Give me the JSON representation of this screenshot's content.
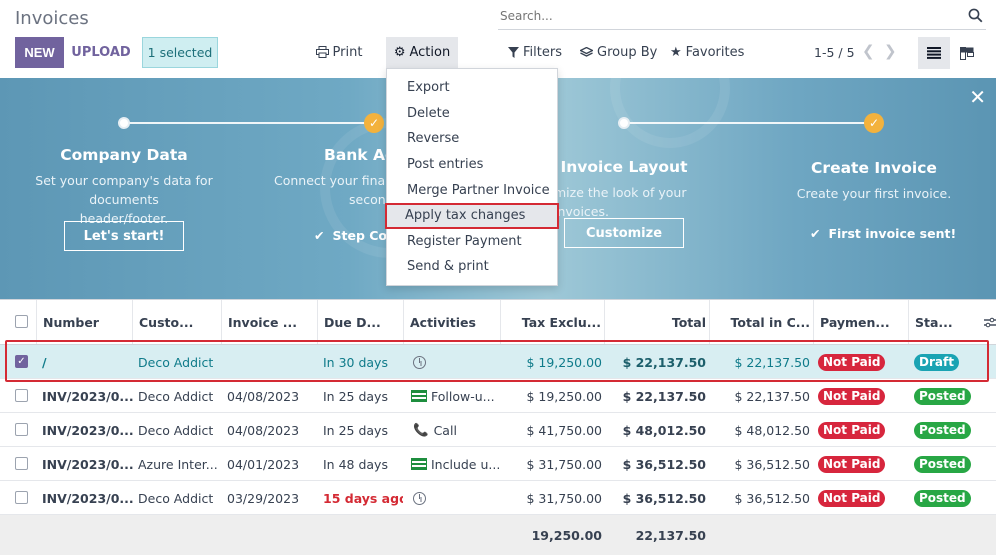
{
  "header": {
    "title": "Invoices",
    "new_label": "NEW",
    "upload_label": "UPLOAD",
    "selected_label": "1 selected",
    "print_label": "Print",
    "action_label": "Action"
  },
  "search": {
    "placeholder": "Search..."
  },
  "filters": {
    "filters_label": "Filters",
    "groupby_label": "Group By",
    "favorites_label": "Favorites"
  },
  "pager": {
    "value": "1-5 / 5"
  },
  "banner": {
    "steps": [
      {
        "title": "Company Data",
        "desc1": "Set your company's data for documents",
        "desc2": "header/footer.",
        "button": "Let's start!"
      },
      {
        "title": "Bank Acc",
        "desc1": "Connect your finan",
        "desc2": "secon",
        "check": "Step Co"
      },
      {
        "title": "Invoice Layout",
        "desc1": "mize the look of your invoices.",
        "button": "Customize"
      },
      {
        "title": "Create Invoice",
        "desc1": "Create your first invoice.",
        "check": "First invoice sent!"
      }
    ]
  },
  "menu": {
    "items": [
      "Export",
      "Delete",
      "Reverse",
      "Post entries",
      "Merge Partner Invoice",
      "Apply tax changes",
      "Register Payment",
      "Send & print"
    ]
  },
  "table": {
    "headers": [
      "Number",
      "Custo...",
      "Invoice ...",
      "Due D...",
      "Activities",
      "Tax Exclu...",
      "Total",
      "Total in C...",
      "Paymen...",
      "Sta..."
    ],
    "rows": [
      {
        "number": "/",
        "customer": "Deco Addict",
        "invoice_date": "",
        "due": "In 30 days",
        "activity": "",
        "tax_excl": "$ 19,250.00",
        "total": "$ 22,137.50",
        "total_cur": "$ 22,137.50",
        "payment": "Not Paid",
        "status": "Draft"
      },
      {
        "number": "INV/2023/0...",
        "customer": "Deco Addict",
        "invoice_date": "04/08/2023",
        "due": "In 25 days",
        "activity": "Follow-u...",
        "tax_excl": "$ 19,250.00",
        "total": "$ 22,137.50",
        "total_cur": "$ 22,137.50",
        "payment": "Not Paid",
        "status": "Posted"
      },
      {
        "number": "INV/2023/0...",
        "customer": "Deco Addict",
        "invoice_date": "04/08/2023",
        "due": "In 25 days",
        "activity": "Call",
        "tax_excl": "$ 41,750.00",
        "total": "$ 48,012.50",
        "total_cur": "$ 48,012.50",
        "payment": "Not Paid",
        "status": "Posted"
      },
      {
        "number": "INV/2023/0...",
        "customer": "Azure Inter...",
        "invoice_date": "04/01/2023",
        "due": "In 48 days",
        "activity": "Include u...",
        "tax_excl": "$ 31,750.00",
        "total": "$ 36,512.50",
        "total_cur": "$ 36,512.50",
        "payment": "Not Paid",
        "status": "Posted"
      },
      {
        "number": "INV/2023/0...",
        "customer": "Deco Addict",
        "invoice_date": "03/29/2023",
        "due": "15 days ago",
        "activity": "",
        "tax_excl": "$ 31,750.00",
        "total": "$ 36,512.50",
        "total_cur": "$ 36,512.50",
        "payment": "Not Paid",
        "status": "Posted"
      }
    ],
    "footer": {
      "tax_excl": "19,250.00",
      "total": "22,137.50"
    }
  }
}
